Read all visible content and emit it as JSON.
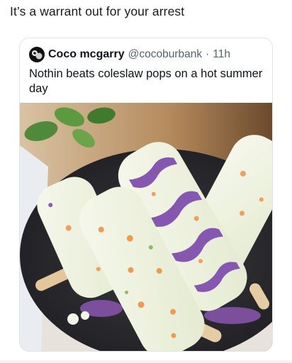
{
  "caption": "It’s a warrant out for your arrest",
  "quoted_tweet": {
    "display_name": "Coco mcgarry",
    "handle": "@cocoburbank",
    "separator": "·",
    "time": "11h",
    "text": "Nothin beats coleslaw pops on a hot summer day"
  },
  "media": {
    "icon": "photo-coleslaw-popsicles"
  },
  "colors": {
    "text_primary": "#0f1419",
    "text_secondary": "#536471",
    "card_border": "#e3e3e3"
  }
}
